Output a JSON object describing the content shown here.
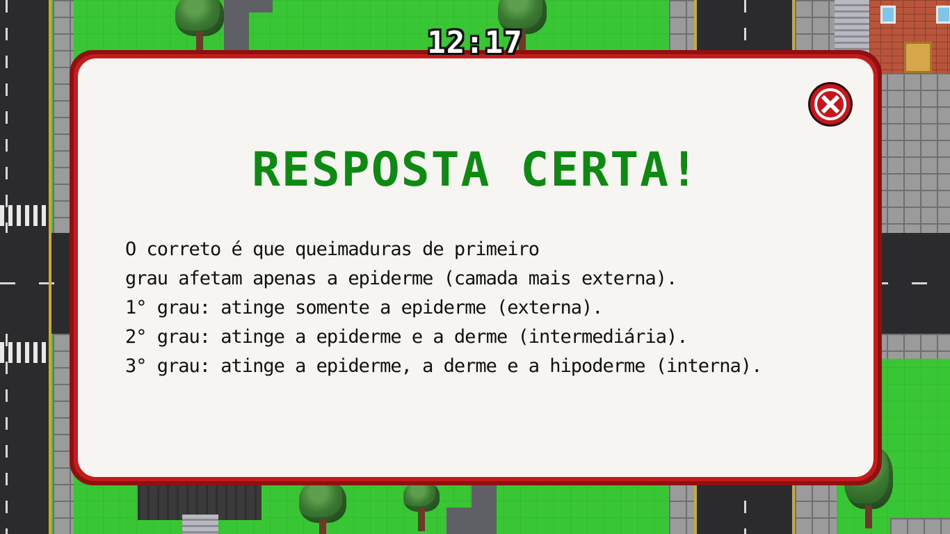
{
  "hud": {
    "clock": "12:17"
  },
  "dialog": {
    "title": "RESPOSTA CERTA!",
    "lines": [
      "O correto é que queimaduras de primeiro",
      "grau afetam apenas a epiderme (camada mais externa).",
      "1° grau: atinge somente a epiderme (externa).",
      "2° grau: atinge a epiderme e a derme (intermediária).",
      "3° grau: atinge a epiderme, a derme e a hipoderme (interna)."
    ],
    "close_icon": "close-x-icon"
  },
  "colors": {
    "title_green": "#0e8a12",
    "border_red": "#c41b1b",
    "panel": "#f6f5f2",
    "grass": "#38c634",
    "road": "#2b2b2d"
  }
}
